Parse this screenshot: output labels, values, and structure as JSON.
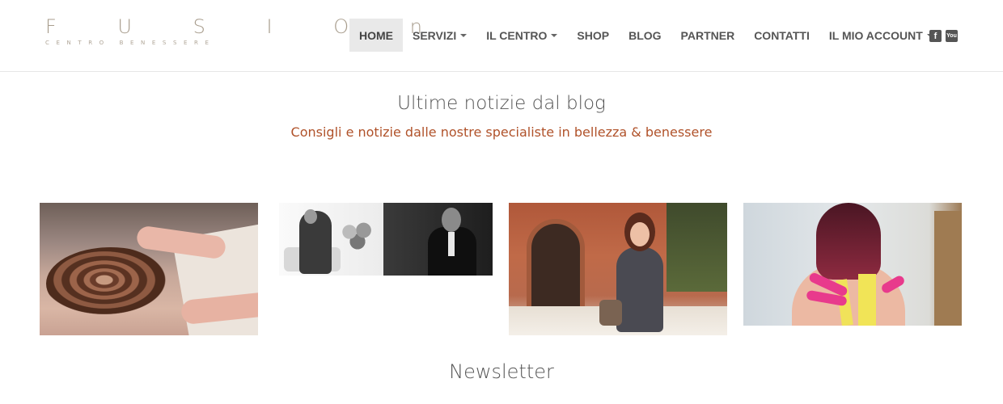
{
  "logo": {
    "word": "Fusion",
    "tagline": "CENTRO BENESSERE"
  },
  "nav": {
    "items": [
      {
        "label": "HOME",
        "active": true,
        "dropdown": false
      },
      {
        "label": "SERVIZI",
        "active": false,
        "dropdown": true
      },
      {
        "label": "IL CENTRO",
        "active": false,
        "dropdown": true
      },
      {
        "label": "SHOP",
        "active": false,
        "dropdown": false
      },
      {
        "label": "BLOG",
        "active": false,
        "dropdown": false
      },
      {
        "label": "PARTNER",
        "active": false,
        "dropdown": false
      },
      {
        "label": "CONTATTI",
        "active": false,
        "dropdown": false
      },
      {
        "label": "IL MIO ACCOUNT",
        "active": false,
        "dropdown": true
      }
    ]
  },
  "social": {
    "icons": [
      "facebook-icon",
      "youtube-icon"
    ]
  },
  "blog": {
    "title": "Ultime notizie dal blog",
    "subtitle": "Consigli e notizie dalle nostre specialiste in bellezza & benessere"
  },
  "posts": [
    {
      "image": "spa-treatment-photo"
    },
    {
      "image": "specialists-portrait-photo"
    },
    {
      "image": "woman-with-bicycle-photo"
    },
    {
      "image": "kinesio-tape-photo"
    }
  ],
  "newsletter": {
    "title": "Newsletter"
  },
  "colors": {
    "accent": "#b0522a",
    "logo": "#a89d8d",
    "nav_active_bg": "#e9e9e9"
  }
}
